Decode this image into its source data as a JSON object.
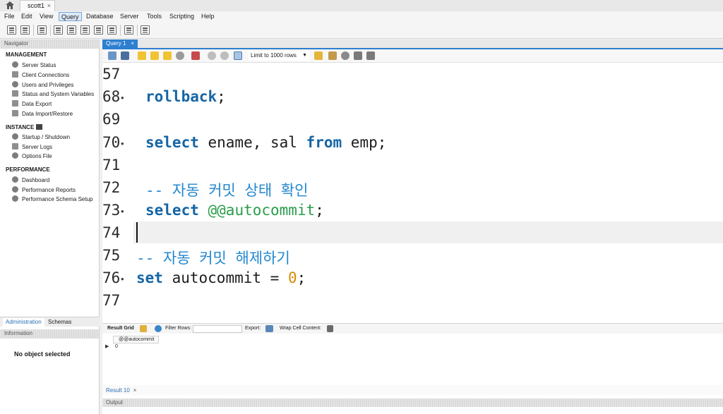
{
  "connection_tab": {
    "title": "scott1",
    "close": "×"
  },
  "menu": [
    "File",
    "Edit",
    "View",
    "Query",
    "Database",
    "Server",
    "Tools",
    "Scripting",
    "Help"
  ],
  "active_menu": "Query",
  "navigator": {
    "header": "Navigator",
    "management_title": "MANAGEMENT",
    "management": [
      "Server Status",
      "Client Connections",
      "Users and Privileges",
      "Status and System Variables",
      "Data Export",
      "Data Import/Restore"
    ],
    "instance_title": "INSTANCE",
    "instance": [
      "Startup / Shutdown",
      "Server Logs",
      "Options File"
    ],
    "performance_title": "PERFORMANCE",
    "performance": [
      "Dashboard",
      "Performance Reports",
      "Performance Schema Setup"
    ]
  },
  "side_tabs": [
    "Administration",
    "Schemas"
  ],
  "information": {
    "header": "Information",
    "message": "No object selected"
  },
  "query_tab": {
    "title": "Query 1",
    "close": "×"
  },
  "query_toolbar": {
    "limit_label": "Limit to 1000 rows"
  },
  "editor": {
    "lines": [
      {
        "num": "57",
        "dot": false
      },
      {
        "num": "68",
        "dot": true
      },
      {
        "num": "69",
        "dot": false
      },
      {
        "num": "70",
        "dot": true
      },
      {
        "num": "71",
        "dot": false
      },
      {
        "num": "72",
        "dot": false
      },
      {
        "num": "73",
        "dot": true
      },
      {
        "num": "74",
        "dot": false
      },
      {
        "num": "75",
        "dot": false
      },
      {
        "num": "76",
        "dot": true
      },
      {
        "num": "77",
        "dot": false
      }
    ],
    "code": {
      "rollback": "rollback",
      "rollback_end": ";",
      "select1_kw": "select",
      "select1_cols": " ename, sal ",
      "select1_from": "from",
      "select1_table": " emp;",
      "comment1": "-- 자동 커밋 상태 확인",
      "select2_kw": "select",
      "select2_space": " ",
      "select2_var": "@@autocommit",
      "select2_end": ";",
      "comment2": "-- 자동 커밋 해제하기",
      "set_kw": "set",
      "set_mid": " autocommit = ",
      "set_num": "0",
      "set_end": ";"
    }
  },
  "result_toolbar": {
    "result_grid": "Result Grid",
    "filter_rows": "Filter Rows:",
    "export": "Export:",
    "wrap": "Wrap Cell Content:"
  },
  "result_grid": {
    "columns": [
      "@@autocommit"
    ],
    "rows": [
      [
        "0"
      ]
    ]
  },
  "result_tab": {
    "title": "Result 10",
    "close": "×"
  },
  "output": {
    "header": "Output"
  }
}
